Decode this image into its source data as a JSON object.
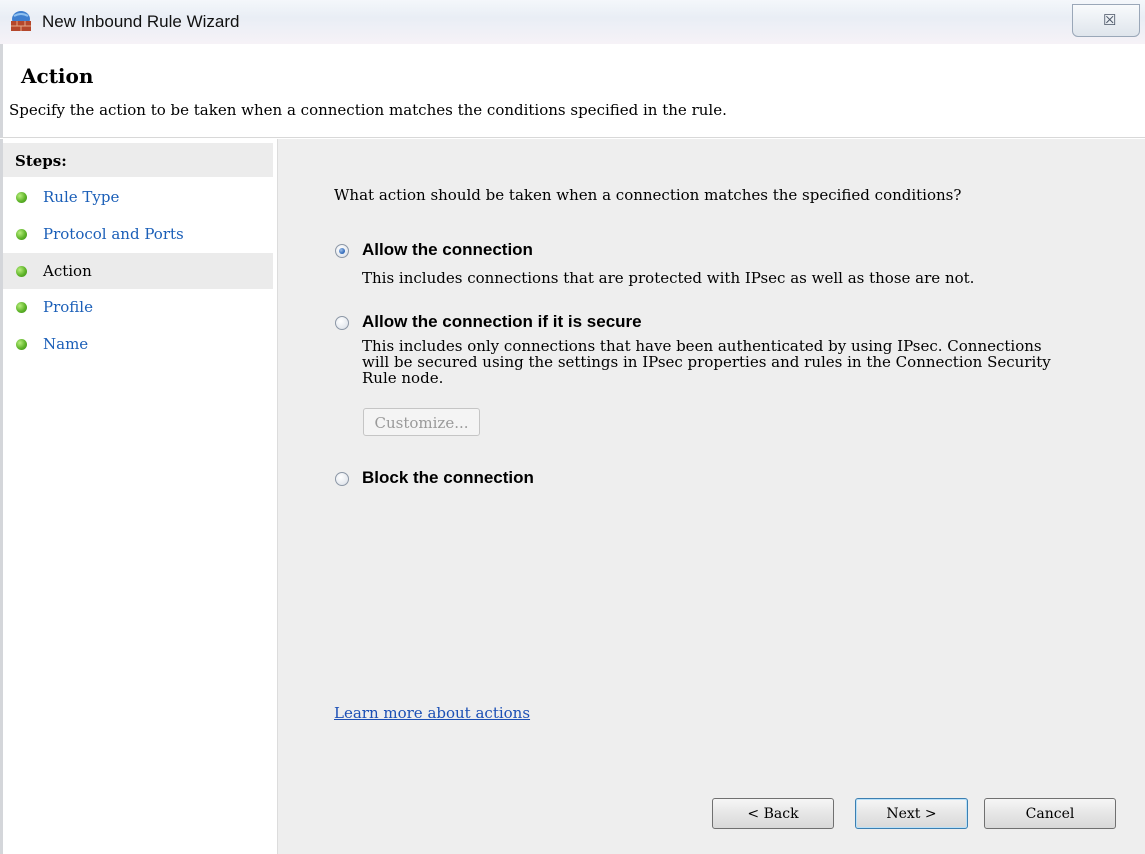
{
  "window": {
    "title": "New Inbound Rule Wizard",
    "close_label": "☒"
  },
  "header": {
    "title": "Action",
    "description": "Specify the action to be taken when a connection matches the conditions specified in the rule."
  },
  "steps": {
    "heading": "Steps:",
    "items": [
      {
        "label": "Rule Type",
        "current": false
      },
      {
        "label": "Protocol and Ports",
        "current": false
      },
      {
        "label": "Action",
        "current": true
      },
      {
        "label": "Profile",
        "current": false
      },
      {
        "label": "Name",
        "current": false
      }
    ]
  },
  "main": {
    "question": "What action should be taken when a connection matches the specified conditions?",
    "options": [
      {
        "label": "Allow the connection",
        "checked": true,
        "description": "This includes connections that are protected with IPsec as well as those are not."
      },
      {
        "label": "Allow the connection if it is secure",
        "checked": false,
        "description": "This includes only connections that have been authenticated by using IPsec.  Connections will be secured using the settings in IPsec properties and rules in the Connection Security Rule node."
      },
      {
        "label": "Block the connection",
        "checked": false,
        "description": ""
      }
    ],
    "customize_label": "Customize...",
    "learn_more": "Learn more about actions"
  },
  "footer": {
    "back_label": "< Back",
    "next_label": "Next >",
    "cancel_label": "Cancel"
  }
}
